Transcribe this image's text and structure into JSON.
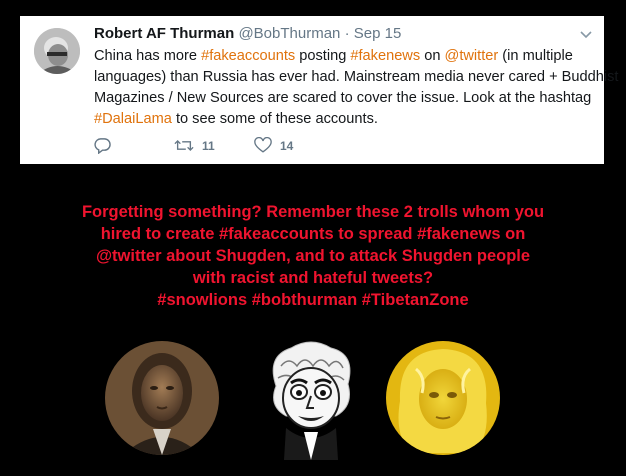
{
  "tweet": {
    "author_name": "Robert AF Thurman",
    "handle": "@BobThurman",
    "separator": "·",
    "date": "Sep 15",
    "lines": [
      [
        {
          "t": "China has more "
        },
        {
          "t": "#fakeaccounts",
          "tag": true
        },
        {
          "t": " posting "
        },
        {
          "t": "#fakenews",
          "tag": true
        },
        {
          "t": " on "
        },
        {
          "t": "@twitter",
          "tag": true
        },
        {
          "t": " (in multiple"
        }
      ],
      [
        {
          "t": "languages) than Russia has ever had. Mainstream media never cared + Buddhist"
        }
      ],
      [
        {
          "t": "Magazines / New Sources are scared to cover the issue. Look at the hashtag"
        }
      ],
      [
        {
          "t": "#DalaiLama",
          "tag": true
        },
        {
          "t": " to see some of these accounts."
        }
      ]
    ],
    "retweet_count": "11",
    "like_count": "14",
    "icons": {
      "reply": "reply-icon",
      "retweet": "retweet-icon",
      "like": "heart-icon",
      "menu": "chevron-down-icon"
    },
    "accent_color": "#e0730d"
  },
  "caption": {
    "lines": [
      "Forgetting something? Remember these 2 trolls whom you",
      "hired to create #fakeaccounts to spread #fakenews on",
      "@twitter about Shugden, and to attack Shugden people",
      "with racist and hateful tweets?",
      "#snowlions #bobthurman #TibetanZone"
    ],
    "color": "#f0142f"
  }
}
